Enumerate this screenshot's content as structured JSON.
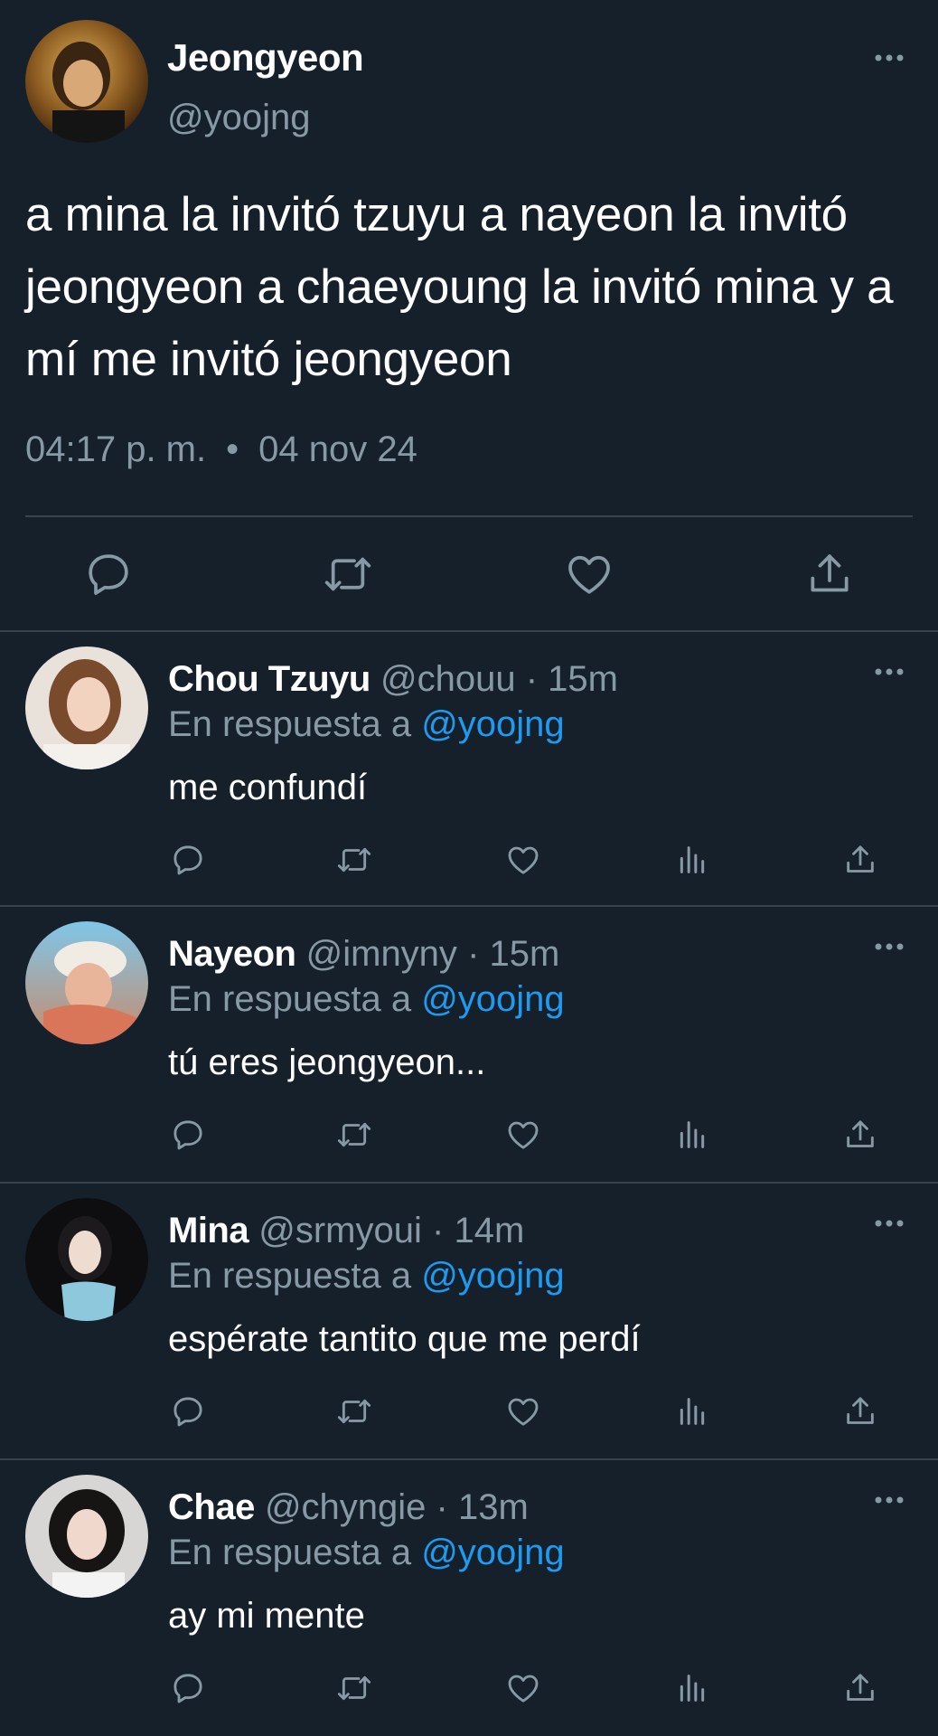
{
  "main_tweet": {
    "name": "Jeongyeon",
    "handle": "@yoojng",
    "text": "a mina la invitó tzuyu a nayeon la invitó jeongyeon a chaeyoung la invitó mina y a mí me invitó jeongyeon",
    "time": "04:17 p. m.",
    "separator": "•",
    "date": "04 nov 24"
  },
  "replies": [
    {
      "name": "Chou Tzuyu",
      "handle": "@chouu",
      "sep": "·",
      "time": "15m",
      "reply_to_label": "En respuesta a",
      "reply_to": "@yoojng",
      "text": "me confundí"
    },
    {
      "name": "Nayeon",
      "handle": "@imnyny",
      "sep": "·",
      "time": "15m",
      "reply_to_label": "En respuesta a",
      "reply_to": "@yoojng",
      "text": "tú eres jeongyeon..."
    },
    {
      "name": "Mina",
      "handle": "@srmyoui",
      "sep": "·",
      "time": "14m",
      "reply_to_label": "En respuesta a",
      "reply_to": "@yoojng",
      "text": "espérate tantito que me perdí"
    },
    {
      "name": "Chae",
      "handle": "@chyngie",
      "sep": "·",
      "time": "13m",
      "reply_to_label": "En respuesta a",
      "reply_to": "@yoojng",
      "text": "ay mi mente"
    }
  ],
  "icons": [
    "more-icon",
    "reply-icon",
    "retweet-icon",
    "like-icon",
    "share-icon",
    "analytics-icon"
  ],
  "colors": {
    "background": "#15202b",
    "border": "#38444d",
    "secondary_text": "#8899a6",
    "link": "#1d9bf0",
    "icon": "#8899a6"
  }
}
